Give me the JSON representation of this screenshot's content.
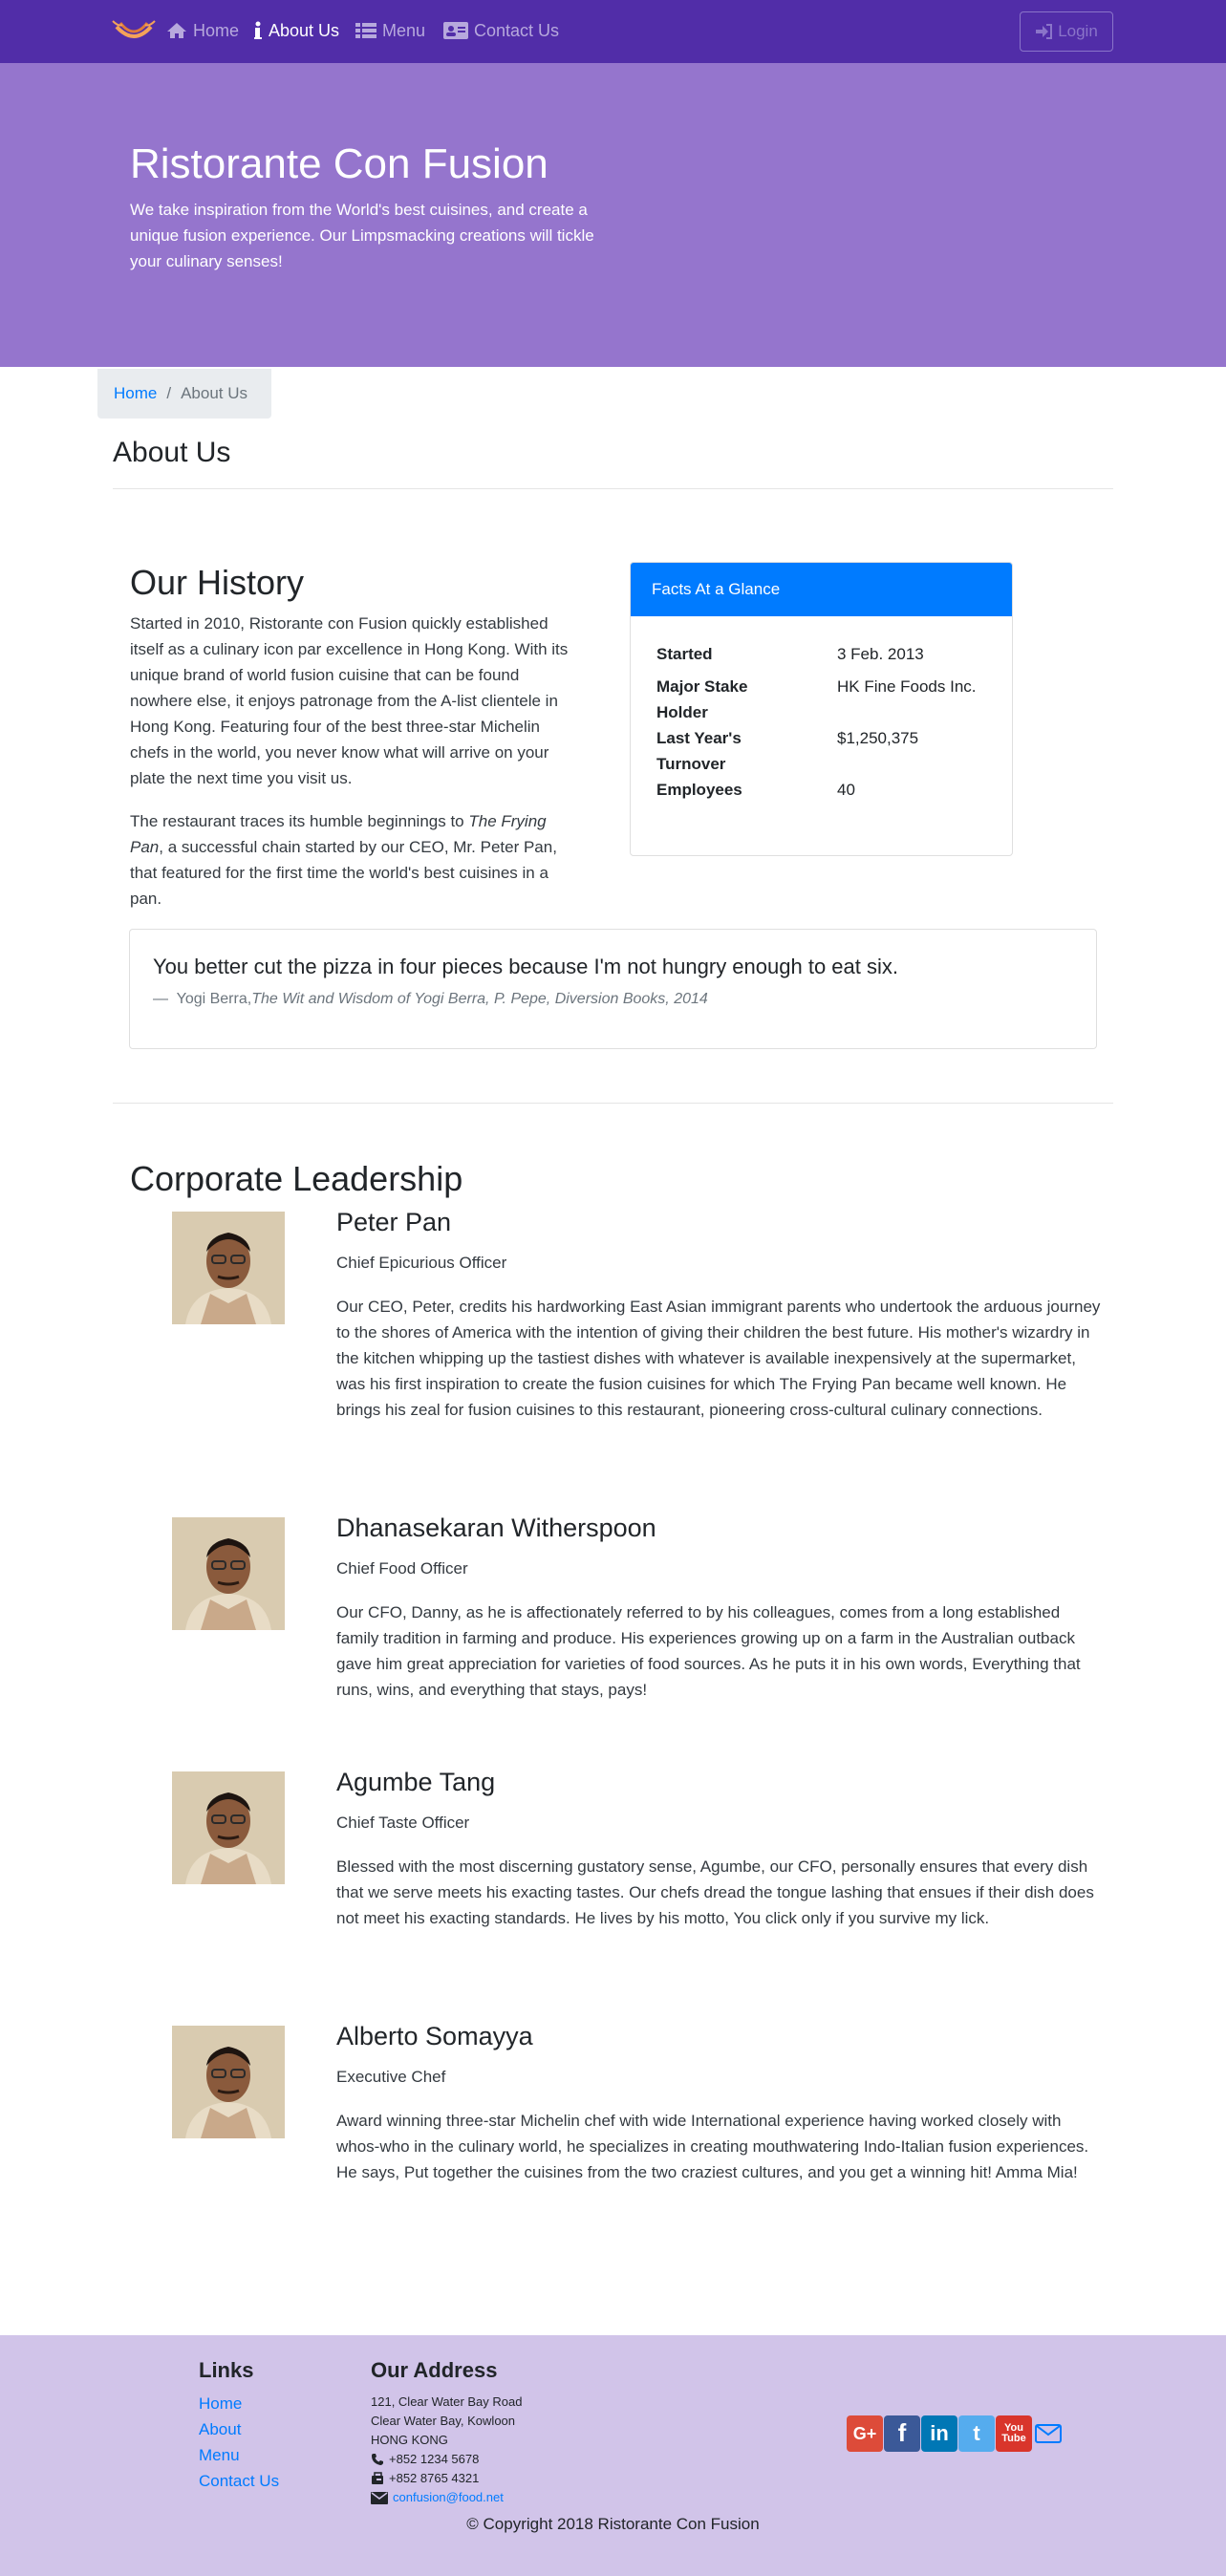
{
  "nav": {
    "items": [
      {
        "label": "Home",
        "icon": "home-icon"
      },
      {
        "label": "About Us",
        "icon": "info-icon"
      },
      {
        "label": "Menu",
        "icon": "list-icon"
      },
      {
        "label": "Contact Us",
        "icon": "address-card-icon"
      }
    ],
    "login_label": "Login"
  },
  "jumbotron": {
    "title": "Ristorante Con Fusion",
    "text": "We take inspiration from the World's best cuisines, and create a unique fusion experience. Our Limpsmacking creations will tickle your culinary senses!"
  },
  "breadcrumb": {
    "home": "Home",
    "current": "About Us"
  },
  "page_title": "About Us",
  "history": {
    "heading": "Our History",
    "p1": "Started in 2010, Ristorante con Fusion quickly established itself as a culinary icon par excellence in Hong Kong. With its unique brand of world fusion cuisine that can be found nowhere else, it enjoys patronage from the A-list clientele in Hong Kong. Featuring four of the best three-star Michelin chefs in the world, you never know what will arrive on your plate the next time you visit us.",
    "p2_before": "The restaurant traces its humble beginnings to ",
    "p2_em": "The Frying Pan",
    "p2_after": ", a successful chain started by our CEO, Mr. Peter Pan, that featured for the first time the world's best cuisines in a pan."
  },
  "facts": {
    "header": "Facts At a Glance",
    "rows": [
      {
        "term": "Started",
        "value": "3 Feb. 2013"
      },
      {
        "term": "Major Stake Holder",
        "value": "HK Fine Foods Inc."
      },
      {
        "term": "Last Year's Turnover",
        "value": "$1,250,375"
      },
      {
        "term": "Employees",
        "value": "40"
      }
    ]
  },
  "quote": {
    "text": "You better cut the pizza in four pieces because I'm not hungry enough to eat six.",
    "dash": "—",
    "author": "Yogi Berra,",
    "source": "The Wit and Wisdom of Yogi Berra, P. Pepe, Diversion Books, 2014"
  },
  "leadership": {
    "heading": "Corporate Leadership",
    "leaders": [
      {
        "name": "Peter Pan",
        "role": "Chief Epicurious Officer",
        "description": "Our CEO, Peter, credits his hardworking East Asian immigrant parents who undertook the arduous journey to the shores of America with the intention of giving their children the best future. His mother's wizardry in the kitchen whipping up the tastiest dishes with whatever is available inexpensively at the supermarket, was his first inspiration to create the fusion cuisines for which The Frying Pan became well known. He brings his zeal for fusion cuisines to this restaurant, pioneering cross-cultural culinary connections."
      },
      {
        "name": "Dhanasekaran Witherspoon",
        "role": "Chief Food Officer",
        "description": "Our CFO, Danny, as he is affectionately referred to by his colleagues, comes from a long established family tradition in farming and produce. His experiences growing up on a farm in the Australian outback gave him great appreciation for varieties of food sources. As he puts it in his own words, Everything that runs, wins, and everything that stays, pays!"
      },
      {
        "name": "Agumbe Tang",
        "role": "Chief Taste Officer",
        "description": "Blessed with the most discerning gustatory sense, Agumbe, our CFO, personally ensures that every dish that we serve meets his exacting tastes. Our chefs dread the tongue lashing that ensues if their dish does not meet his exacting standards. He lives by his motto, You click only if you survive my lick."
      },
      {
        "name": "Alberto Somayya",
        "role": "Executive Chef",
        "description": "Award winning three-star Michelin chef with wide International experience having worked closely with whos-who in the culinary world, he specializes in creating mouthwatering Indo-Italian fusion experiences. He says, Put together the cuisines from the two craziest cultures, and you get a winning hit! Amma Mia!"
      }
    ]
  },
  "footer": {
    "links_heading": "Links",
    "links": [
      "Home",
      "About",
      "Menu",
      "Contact Us"
    ],
    "address_heading": "Our Address",
    "address_lines": [
      "121, Clear Water Bay Road",
      "Clear Water Bay, Kowloon",
      "HONG KONG"
    ],
    "phone": "+852 1234 5678",
    "fax": "+852 8765 4321",
    "email": "confusion@food.net",
    "social": [
      {
        "name": "google-plus",
        "label": "G+",
        "color": "#dd4b39"
      },
      {
        "name": "facebook",
        "label": "f",
        "color": "#3b5998"
      },
      {
        "name": "linkedin",
        "label": "in",
        "color": "#0077b5"
      },
      {
        "name": "twitter",
        "label": "t",
        "color": "#55acee"
      },
      {
        "name": "youtube",
        "label": "You Tube",
        "color": "#d9352b"
      }
    ],
    "copyright": "© Copyright 2018 Ristorante Con Fusion"
  },
  "colors": {
    "navbar": "#512da8",
    "jumbotron": "#9575cd",
    "footer": "#d1c4e9",
    "primary": "#007bff"
  }
}
